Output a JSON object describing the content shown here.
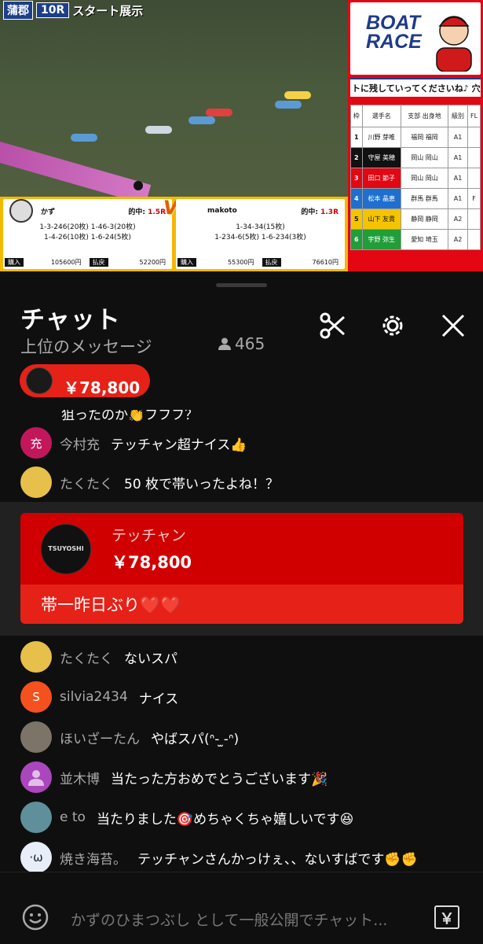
{
  "video": {
    "venue_logo": "蒲郡",
    "race_label": "10R",
    "race_status": "スタート展示",
    "ticker": "トに残していってくださいね♪ 穴党カ",
    "brand_line1": "BOAT",
    "brand_line2": "RACE",
    "table_headers": [
      "枠",
      "選手名",
      "支部 出身地",
      "級別",
      "FL"
    ],
    "racers": [
      {
        "lane": "1",
        "name": "川野 芽唯",
        "branch": "福岡 福岡",
        "class": "A1",
        "fl": "",
        "color": "#ffffff"
      },
      {
        "lane": "2",
        "name": "守屋 美穂",
        "branch": "岡山 岡山",
        "class": "A1",
        "fl": "",
        "color": "#111111"
      },
      {
        "lane": "3",
        "name": "田口 節子",
        "branch": "岡山 岡山",
        "class": "A1",
        "fl": "",
        "color": "#e30613"
      },
      {
        "lane": "4",
        "name": "松本 晶恵",
        "branch": "群馬 群馬",
        "class": "A1",
        "fl": "F",
        "color": "#1e6fd0"
      },
      {
        "lane": "5",
        "name": "山下 友貴",
        "branch": "静岡 静岡",
        "class": "A2",
        "fl": "",
        "color": "#f5c400"
      },
      {
        "lane": "6",
        "name": "宇野 弥生",
        "branch": "愛知 埼玉",
        "class": "A2",
        "fl": "",
        "color": "#1f9e3a"
      }
    ],
    "players": [
      {
        "name": "かず",
        "hit_label": "的中:",
        "hit_value": "1.5R",
        "bets": [
          "1-3-246(20枚)  1-46-3(20枚)",
          "1-4-26(10枚)  1-6-24(5枚)"
        ],
        "buy_label": "購入",
        "buy_value": "105600円",
        "pay_label": "払戻",
        "pay_value": "52200円"
      },
      {
        "name": "makoto",
        "hit_label": "的中:",
        "hit_value": "1.3R",
        "bets": [
          "1-34-34(15枚)",
          "1-234-6(5枚)  1-6-234(3枚)"
        ],
        "buy_label": "購入",
        "buy_value": "55300円",
        "pay_label": "払戻",
        "pay_value": "76610円"
      }
    ],
    "vs_label": "VS"
  },
  "chat": {
    "title": "チャット",
    "subtitle": "上位のメッセージ",
    "viewer_count": "465",
    "pinned_amount": "￥78,800",
    "partial_message": "狙ったのか👏フフフ？",
    "messages_top": [
      {
        "author": "今村充",
        "text": "テッチャン超ナイス👍",
        "avatar_letter": "充",
        "avatar_color": "#c2185b"
      },
      {
        "author": "たくたく",
        "text": "50 枚で帯いったよね！？",
        "avatar_letter": "",
        "avatar_color": "#e6c04a"
      }
    ],
    "superchat": {
      "author": "テッチャン",
      "amount": "￥78,800",
      "message": "帯一昨日ぶり❤️❤️",
      "avatar_text": "TSUYOSHI"
    },
    "messages_bottom": [
      {
        "author": "たくたく",
        "text": "ないスパ",
        "avatar_letter": "",
        "avatar_color": "#e6c04a"
      },
      {
        "author": "silvia2434",
        "text": "ナイス",
        "avatar_letter": "S",
        "avatar_color": "#f4511e"
      },
      {
        "author": "ほいざーたん",
        "text": "やばスパ(ᐢ- ̫-ᐢ)",
        "avatar_letter": "",
        "avatar_color": "#7d7468"
      },
      {
        "author": "並木博",
        "text": "当たった方おめでとうございます🎉",
        "avatar_letter": "",
        "avatar_color": "#ab47bc"
      },
      {
        "author": "e to",
        "text": "当たりました🎯めちゃくちゃ嬉しいです😆",
        "avatar_letter": "",
        "avatar_color": "#5f8f9a"
      },
      {
        "author": "焼き海苔。",
        "text": "テッチャンさんかっけぇ、、ないすばです✊✊",
        "avatar_letter": "·ω",
        "avatar_color": "#e8eef7"
      }
    ],
    "input_placeholder": "かずのひまつぶし として一般公開でチャット...",
    "yen_button": "￥"
  }
}
